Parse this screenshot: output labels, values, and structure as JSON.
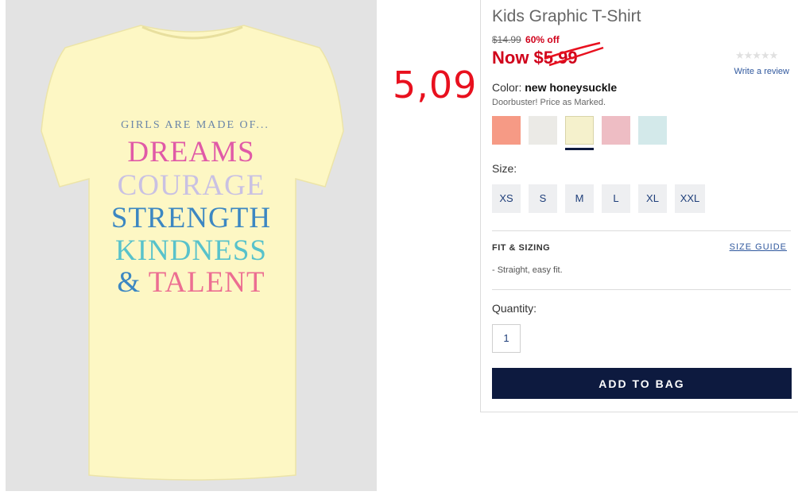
{
  "product": {
    "shirt_lines": {
      "girls": "GIRLS ARE MADE OF...",
      "dreams": "DREAMS",
      "courage": "COURAGE",
      "strength": "STRENGTH",
      "kindness": "KINDNESS",
      "amp": "&",
      "talent": "TALENT"
    }
  },
  "annotation": {
    "price_note": "5,09"
  },
  "details": {
    "title": "Kids Graphic T-Shirt",
    "original_price": "$14.99",
    "discount": "60% off",
    "now_price": "Now $5.99",
    "rating_stars": "★★★★★",
    "review_link": "Write a review",
    "color_label": "Color:",
    "color_value": "new honeysuckle",
    "note": "Doorbuster! Price as Marked.",
    "swatches": [
      {
        "color": "#f69a85"
      },
      {
        "color": "#ebeae6"
      },
      {
        "color": "#f5f1cc",
        "selected": true
      },
      {
        "color": "#eebdc4"
      },
      {
        "color": "#d3e9ea"
      }
    ],
    "size_label": "Size:",
    "sizes": [
      "XS",
      "S",
      "M",
      "L",
      "XL",
      "XXL"
    ],
    "fit_heading": "FIT & SIZING",
    "size_guide": "SIZE GUIDE",
    "fit_text": "-  Straight, easy fit.",
    "quantity_label": "Quantity:",
    "quantity": "1",
    "add_to_bag": "ADD TO BAG"
  },
  "colors": {
    "shirt": "#fdf7c4",
    "sale_red": "#d0021b",
    "navy": "#0d1a3f",
    "link_blue": "#31599e"
  }
}
